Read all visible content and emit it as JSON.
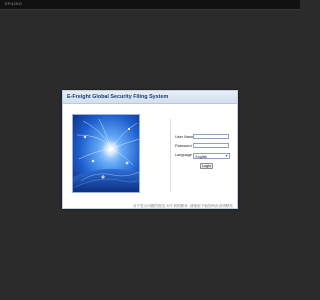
{
  "topbar": {
    "title": "EFILING"
  },
  "window": {
    "title": "E-Freight Global Security Filing System"
  },
  "form": {
    "username_label": "User Name",
    "username_value": "",
    "password_label": "Password",
    "password_value": "",
    "language_label": "Language",
    "language_selected": "English",
    "login_label": "Login"
  },
  "footer": {
    "note": "对于显示问题的报告:对于其他联系 ,请使用下面的网页说明联系"
  },
  "colors": {
    "page_background": "#2b2b2b",
    "window_background": "#ffffff",
    "title_text": "#1b3c76",
    "banner_blue": "#1f5fcf"
  },
  "icons": {
    "language_dropdown": "chevron-down-icon"
  }
}
